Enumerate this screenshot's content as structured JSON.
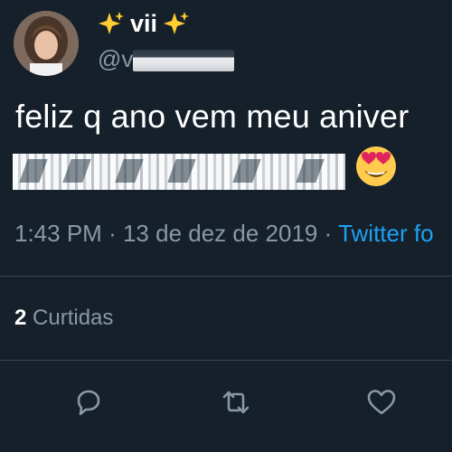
{
  "user": {
    "display_name": "vii",
    "handle_visible": "@vi",
    "avatar_icon": "profile-photo"
  },
  "tweet": {
    "text": "feliz q ano vem meu aniver",
    "emoji": "heart-eyes-emoji"
  },
  "meta": {
    "time": "1:43 PM",
    "date": "13 de dez de 2019",
    "separator": "·",
    "source": "Twitter fo"
  },
  "stats": {
    "likes_count": "2",
    "likes_label": "Curtidas"
  },
  "actions": [
    {
      "name": "reply",
      "icon": "reply-icon"
    },
    {
      "name": "retweet",
      "icon": "retweet-icon"
    },
    {
      "name": "like",
      "icon": "heart-icon"
    }
  ],
  "colors": {
    "background": "#15202b",
    "secondary_text": "#8899a6",
    "link": "#1da1f2",
    "divider": "#38444d"
  }
}
